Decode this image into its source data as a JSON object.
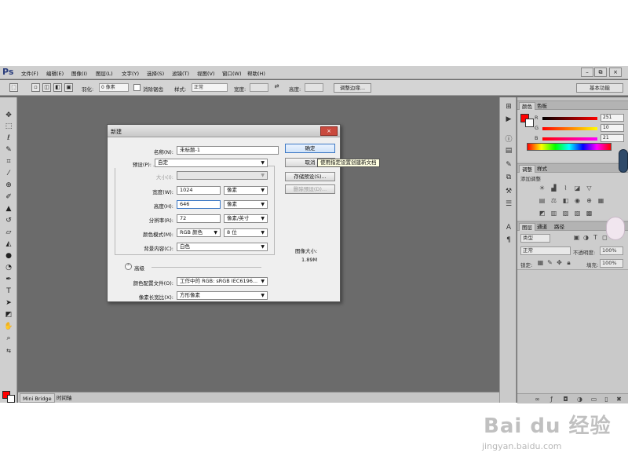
{
  "app": {
    "logo": "Ps"
  },
  "menu": [
    "文件(F)",
    "编辑(E)",
    "图像(I)",
    "图层(L)",
    "文字(Y)",
    "选择(S)",
    "滤镜(T)",
    "视图(V)",
    "窗口(W)",
    "帮助(H)"
  ],
  "window_buttons": [
    "–",
    "⧉",
    "×"
  ],
  "options": {
    "feather_label": "羽化:",
    "feather_value": "0 像素",
    "antialias_label": "消除锯齿",
    "style_label": "样式:",
    "style_value": "正常",
    "width_label": "宽度:",
    "height_label": "高度:",
    "refine_button": "调整边缘...",
    "workspace": "基本功能"
  },
  "bottom_tabs": [
    "Mini Bridge",
    "时间轴"
  ],
  "dialog": {
    "title": "新建",
    "close": "×",
    "name_label": "名称(N):",
    "name_value": "未标题-1",
    "preset_label": "预设(P):",
    "preset_value": "自定",
    "size_label": "大小(I):",
    "width_label": "宽度(W):",
    "width_value": "1024",
    "width_unit": "像素",
    "height_label": "高度(H):",
    "height_value": "646",
    "height_unit": "像素",
    "resolution_label": "分辨率(R):",
    "resolution_value": "72",
    "resolution_unit": "像素/英寸",
    "color_mode_label": "颜色模式(M):",
    "color_mode_value": "RGB 颜色",
    "bit_depth_value": "8 位",
    "background_label": "背景内容(C):",
    "background_value": "白色",
    "advanced_label": "高级",
    "profile_label": "颜色配置文件(O):",
    "profile_value": "工作中的 RGB: sRGB IEC6196...",
    "aspect_label": "像素长宽比(X):",
    "aspect_value": "方形像素",
    "ok_button": "确定",
    "cancel_button": "取消",
    "save_preset_button": "存储预设(S)...",
    "delete_preset_button": "删除预设(D)...",
    "image_size_label": "图像大小:",
    "image_size_value": "1.89M",
    "tooltip": "使用指定设置创建新文档"
  },
  "panels": {
    "color_tabs": [
      "颜色",
      "色板"
    ],
    "r_label": "R",
    "g_label": "G",
    "b_label": "B",
    "r_value": "251",
    "g_value": "10",
    "b_value": "21",
    "adjust_tabs": [
      "调整",
      "样式"
    ],
    "adjust_title": "添加调整",
    "layers_tabs": [
      "图层",
      "通道",
      "路径"
    ],
    "kind_value": "类型",
    "blend_value": "正常",
    "opacity_label": "不透明度:",
    "opacity_value": "100%",
    "lock_label": "锁定:",
    "fill_label": "填充:",
    "fill_value": "100%"
  },
  "colors": {
    "foreground": "#ff0000",
    "background": "#ffffff",
    "workspace": "#6b6b6b",
    "accent": "#3b77c4"
  },
  "watermark": {
    "main": "Bai du 经验",
    "sub": "jingyan.baidu.com"
  }
}
